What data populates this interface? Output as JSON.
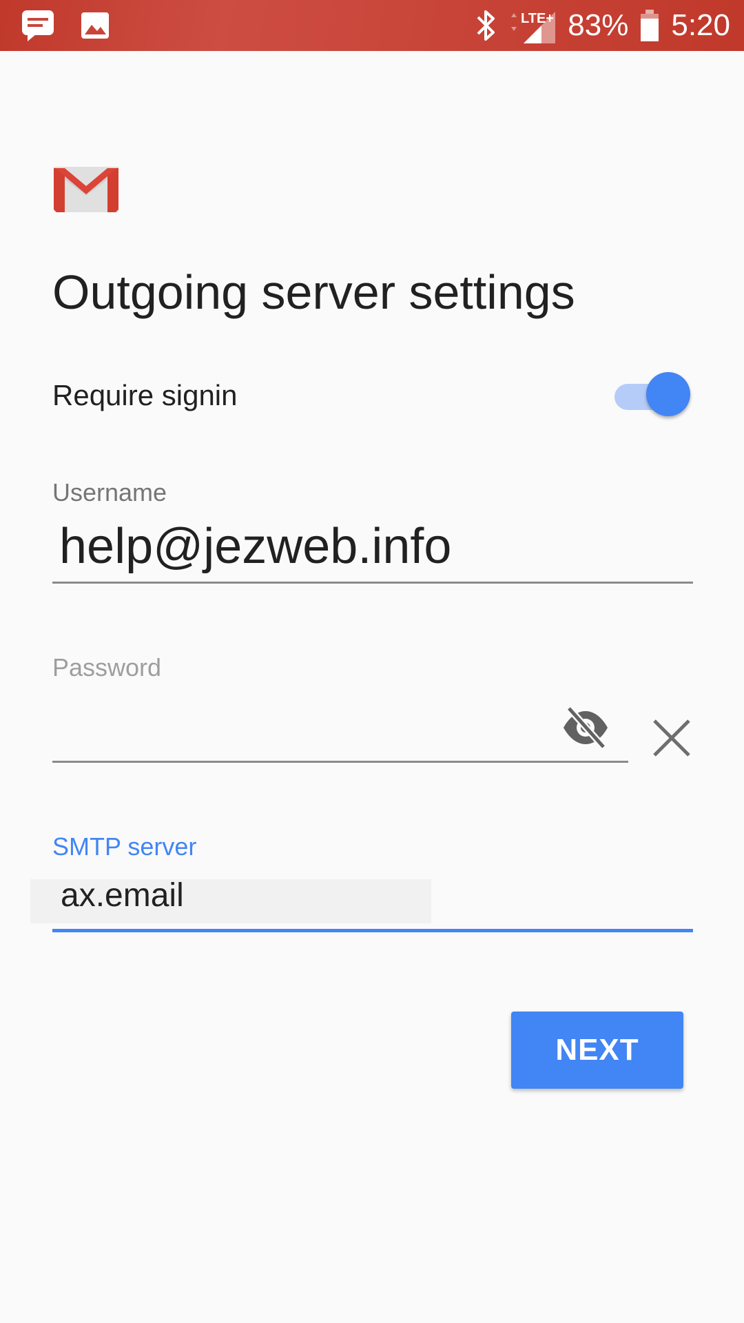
{
  "status_bar": {
    "left_icons": [
      "chat-notification-icon",
      "image-notification-icon"
    ],
    "right_icons": [
      "bluetooth-icon",
      "lte-signal-icon",
      "battery-icon"
    ],
    "network": "LTE+",
    "battery": "83%",
    "time": "5:20",
    "color": "#c0392b"
  },
  "app": {
    "logo": "gmail-logo",
    "title": "Outgoing server settings"
  },
  "require_signin": {
    "label": "Require signin",
    "enabled": true,
    "accent": "#4285f4"
  },
  "username": {
    "label": "Username",
    "value": "help@jezweb.info"
  },
  "password": {
    "label": "Password",
    "value": "",
    "visibility_icon": "eye-off-icon",
    "clear_icon": "close-icon"
  },
  "smtp": {
    "label": "SMTP server",
    "value": "ax.email",
    "focused": true
  },
  "actions": {
    "next_label": "NEXT",
    "color": "#4285f4"
  }
}
